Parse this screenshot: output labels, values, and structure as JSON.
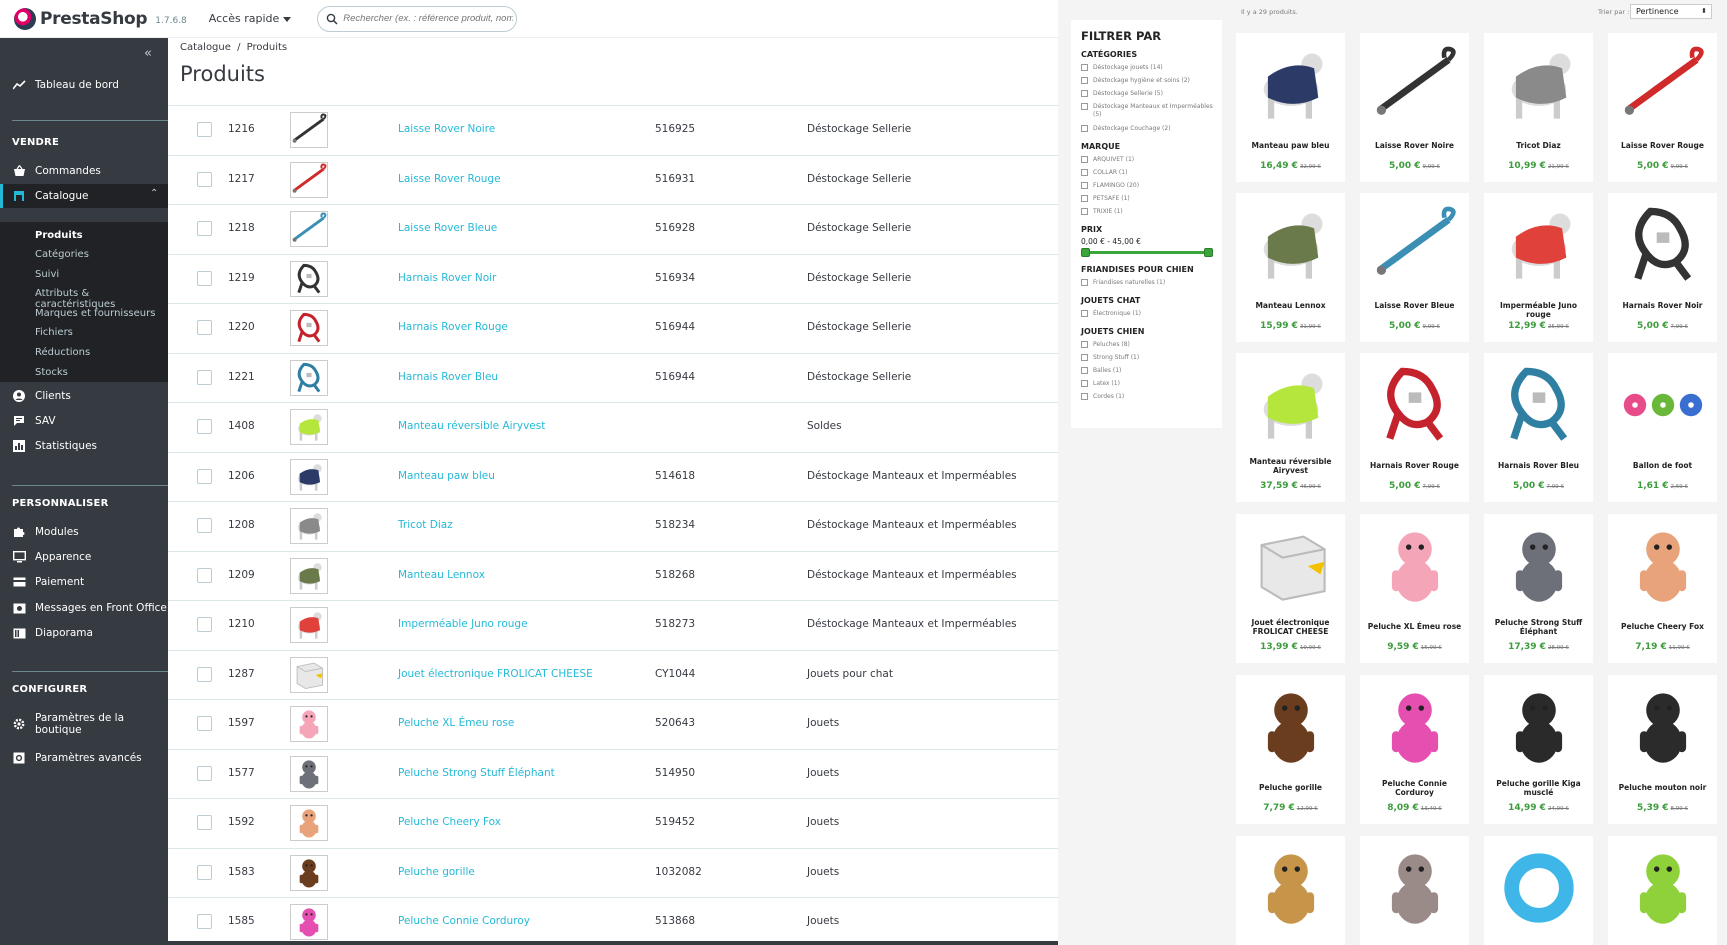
{
  "topbar": {
    "brand": "PrestaShop",
    "version": "1.7.6.8",
    "quick_access": "Accès rapide",
    "search_placeholder": "Rechercher (ex. : référence produit, nom"
  },
  "sidebar": {
    "collapse_icon": "«",
    "dashboard": "Tableau de bord",
    "sell_header": "VENDRE",
    "orders": "Commandes",
    "catalog": "Catalogue",
    "catalog_sub": [
      "Produits",
      "Catégories",
      "Suivi",
      "Attributs & caractéristiques",
      "Marques et fournisseurs",
      "Fichiers",
      "Réductions",
      "Stocks"
    ],
    "customers": "Clients",
    "support": "SAV",
    "stats": "Statistiques",
    "customize_header": "PERSONNALISER",
    "modules": "Modules",
    "appearance": "Apparence",
    "payment": "Paiement",
    "messages": "Messages en Front Office",
    "slideshow": "Diaporama",
    "configure_header": "CONFIGURER",
    "shop_params": "Paramètres de la boutique",
    "advanced_params": "Paramètres avancés"
  },
  "main": {
    "breadcrumb_1": "Catalogue",
    "breadcrumb_sep": "/",
    "breadcrumb_2": "Produits",
    "title": "Produits",
    "rows": [
      {
        "id": "1216",
        "name": "Laisse Rover Noire",
        "ref": "516925",
        "cat": "Déstockage Sellerie",
        "thumb": "leash",
        "color": "#333333"
      },
      {
        "id": "1217",
        "name": "Laisse Rover Rouge",
        "ref": "516931",
        "cat": "Déstockage Sellerie",
        "thumb": "leash",
        "color": "#d02a2a"
      },
      {
        "id": "1218",
        "name": "Laisse Rover Bleue",
        "ref": "516928",
        "cat": "Déstockage Sellerie",
        "thumb": "leash",
        "color": "#3b8fb5"
      },
      {
        "id": "1219",
        "name": "Harnais Rover Noir",
        "ref": "516934",
        "cat": "Déstockage Sellerie",
        "thumb": "harness",
        "color": "#333333"
      },
      {
        "id": "1220",
        "name": "Harnais Rover Rouge",
        "ref": "516944",
        "cat": "Déstockage Sellerie",
        "thumb": "harness",
        "color": "#c4232d"
      },
      {
        "id": "1221",
        "name": "Harnais Rover Bleu",
        "ref": "516944",
        "cat": "Déstockage Sellerie",
        "thumb": "harness",
        "color": "#2f7fa3"
      },
      {
        "id": "1408",
        "name": "Manteau réversible Airyvest",
        "ref": "",
        "cat": "Soldes",
        "thumb": "dog",
        "color": "#b5e63b"
      },
      {
        "id": "1206",
        "name": "Manteau paw bleu",
        "ref": "514618",
        "cat": "Déstockage Manteaux et Imperméables",
        "thumb": "dog",
        "color": "#2b3a66"
      },
      {
        "id": "1208",
        "name": "Tricot Diaz",
        "ref": "518234",
        "cat": "Déstockage Manteaux et Imperméables",
        "thumb": "dog",
        "color": "#8a8a8a"
      },
      {
        "id": "1209",
        "name": "Manteau Lennox",
        "ref": "518268",
        "cat": "Déstockage Manteaux et Imperméables",
        "thumb": "dog",
        "color": "#6b7a4a"
      },
      {
        "id": "1210",
        "name": "Imperméable Juno rouge",
        "ref": "518273",
        "cat": "Déstockage Manteaux et Imperméables",
        "thumb": "dog",
        "color": "#e0413a"
      },
      {
        "id": "1287",
        "name": "Jouet électronique FROLICAT CHEESE",
        "ref": "CY1044",
        "cat": "Jouets pour chat",
        "thumb": "box",
        "color": "#e8e8e8"
      },
      {
        "id": "1597",
        "name": "Peluche XL Émeu rose",
        "ref": "520643",
        "cat": "Jouets",
        "thumb": "plush",
        "color": "#f4a6b8"
      },
      {
        "id": "1577",
        "name": "Peluche Strong Stuff Éléphant",
        "ref": "514950",
        "cat": "Jouets",
        "thumb": "plush",
        "color": "#6d7078"
      },
      {
        "id": "1592",
        "name": "Peluche Cheery Fox",
        "ref": "519452",
        "cat": "Jouets",
        "thumb": "plush",
        "color": "#e8a37a"
      },
      {
        "id": "1583",
        "name": "Peluche gorille",
        "ref": "1032082",
        "cat": "Jouets",
        "thumb": "plush",
        "color": "#6b3d1f"
      },
      {
        "id": "1585",
        "name": "Peluche Connie Corduroy",
        "ref": "513868",
        "cat": "Jouets",
        "thumb": "plush",
        "color": "#e44fb0"
      }
    ]
  },
  "filters": {
    "title": "FILTRER PAR",
    "categories_title": "CATÉGORIES",
    "categories": [
      "Déstockage jouets (14)",
      "Déstockage hygiène et soins (2)",
      "Déstockage Sellerie (5)",
      "Déstockage Manteaux et Imperméables (5)",
      "Déstockage Couchage (2)"
    ],
    "brand_title": "MARQUE",
    "brands": [
      "ARQUIVET (1)",
      "COLLAR (1)",
      "FLAMINGO (20)",
      "PETSAFE (1)",
      "TRIXIE (1)"
    ],
    "price_title": "PRIX",
    "price_range": "0,00 € - 45,00 €",
    "treats_title": "FRIANDISES POUR CHIEN",
    "treats": [
      "Friandises naturelles (1)"
    ],
    "cat_toys_title": "JOUETS CHAT",
    "cat_toys": [
      "Électronique (1)"
    ],
    "dog_toys_title": "JOUETS CHIEN",
    "dog_toys": [
      "Peluches (8)",
      "Strong Stuff (1)",
      "Balles (1)",
      "Latex (1)",
      "Cordes (1)"
    ]
  },
  "shop": {
    "count": "Il y a 29 produits.",
    "sort_label": "Trier par :",
    "sort_value": "Pertinence",
    "products": [
      {
        "name": "Manteau paw bleu",
        "price": "16,49 €",
        "old": "32,99 €",
        "thumb": "dog",
        "color": "#2b3a66"
      },
      {
        "name": "Laisse Rover Noire",
        "price": "5,00 €",
        "old": "9,99 €",
        "thumb": "leash",
        "color": "#333333"
      },
      {
        "name": "Tricot Diaz",
        "price": "10,99 €",
        "old": "21,99 €",
        "thumb": "dog",
        "color": "#8a8a8a"
      },
      {
        "name": "Laisse Rover Rouge",
        "price": "5,00 €",
        "old": "9,99 €",
        "thumb": "leash",
        "color": "#d02a2a"
      },
      {
        "name": "Manteau Lennox",
        "price": "15,99 €",
        "old": "31,99 €",
        "thumb": "dog",
        "color": "#6b7a4a"
      },
      {
        "name": "Laisse Rover Bleue",
        "price": "5,00 €",
        "old": "9,99 €",
        "thumb": "leash",
        "color": "#3b8fb5"
      },
      {
        "name": "Imperméable Juno rouge",
        "price": "12,99 €",
        "old": "25,99 €",
        "thumb": "dog",
        "color": "#e0413a"
      },
      {
        "name": "Harnais Rover Noir",
        "price": "5,00 €",
        "old": "7,99 €",
        "thumb": "harness",
        "color": "#333333"
      },
      {
        "name": "Manteau réversible Airyvest",
        "price": "37,59 €",
        "old": "46,99 €",
        "thumb": "dog",
        "color": "#b5e63b"
      },
      {
        "name": "Harnais Rover Rouge",
        "price": "5,00 €",
        "old": "7,99 €",
        "thumb": "harness",
        "color": "#c4232d"
      },
      {
        "name": "Harnais Rover Bleu",
        "price": "5,00 €",
        "old": "7,99 €",
        "thumb": "harness",
        "color": "#2f7fa3"
      },
      {
        "name": "Ballon de foot",
        "price": "1,61 €",
        "old": "2,69 €",
        "thumb": "balls",
        "color": "#e84b8a"
      },
      {
        "name": "Jouet électronique FROLICAT CHEESE",
        "price": "13,99 €",
        "old": "19,99 €",
        "thumb": "box",
        "color": "#e8e8e8"
      },
      {
        "name": "Peluche XL Émeu rose",
        "price": "9,59 €",
        "old": "15,99 €",
        "thumb": "plush",
        "color": "#f4a6b8"
      },
      {
        "name": "Peluche Strong Stuff Éléphant",
        "price": "17,39 €",
        "old": "28,99 €",
        "thumb": "plush",
        "color": "#6d7078"
      },
      {
        "name": "Peluche Cheery Fox",
        "price": "7,19 €",
        "old": "11,99 €",
        "thumb": "plush",
        "color": "#e8a37a"
      },
      {
        "name": "Peluche gorille",
        "price": "7,79 €",
        "old": "12,99 €",
        "thumb": "plush",
        "color": "#6b3d1f"
      },
      {
        "name": "Peluche Connie Corduroy",
        "price": "8,09 €",
        "old": "13,49 €",
        "thumb": "plush",
        "color": "#e44fb0"
      },
      {
        "name": "Peluche gorille Kiga musclé",
        "price": "14,99 €",
        "old": "24,99 €",
        "thumb": "plush",
        "color": "#2a2a2a"
      },
      {
        "name": "Peluche mouton noir",
        "price": "5,39 €",
        "old": "8,99 €",
        "thumb": "plush",
        "color": "#2b2b2b"
      },
      {
        "name": "",
        "price": "",
        "old": "",
        "thumb": "plush",
        "color": "#c7954a"
      },
      {
        "name": "",
        "price": "",
        "old": "",
        "thumb": "plush",
        "color": "#9a8a88"
      },
      {
        "name": "",
        "price": "",
        "old": "",
        "thumb": "ring",
        "color": "#3fb6e8"
      },
      {
        "name": "",
        "price": "",
        "old": "",
        "thumb": "plush",
        "color": "#8ed13b"
      }
    ]
  }
}
